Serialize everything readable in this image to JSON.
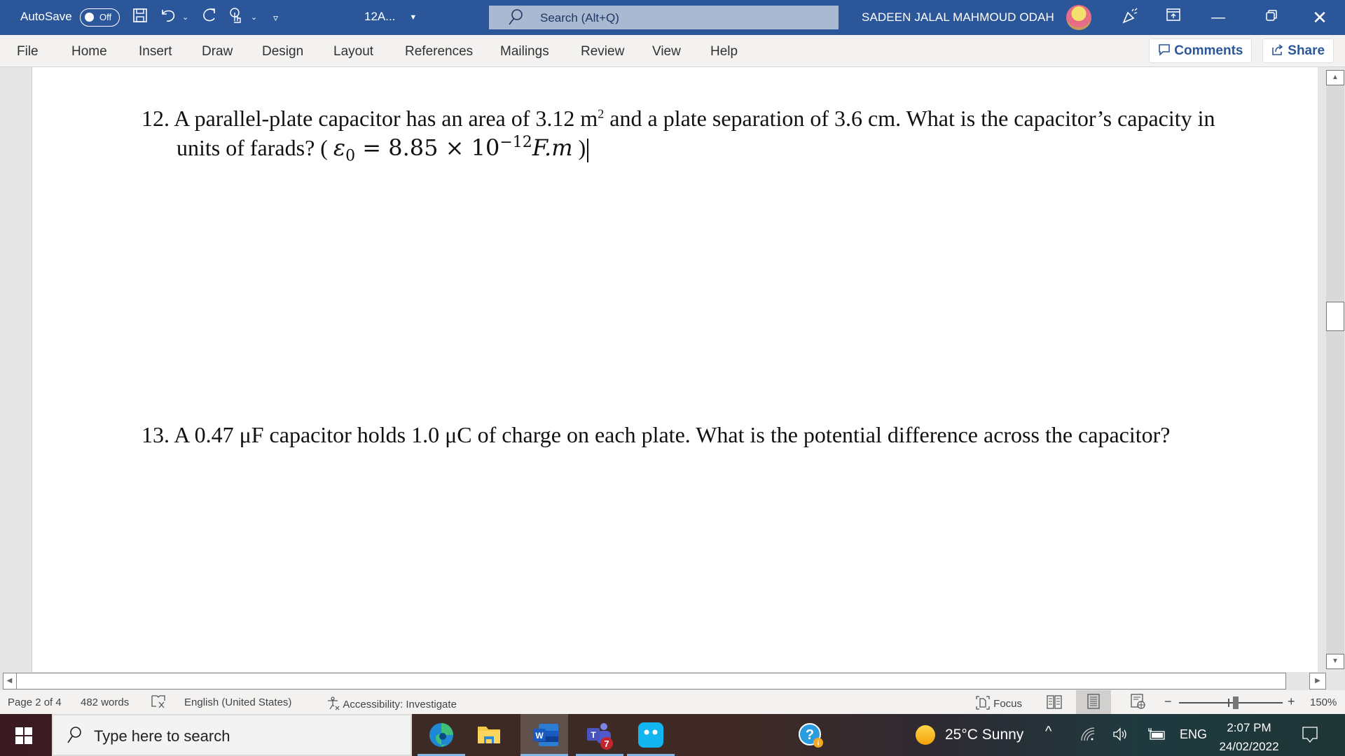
{
  "titlebar": {
    "autosave_label": "AutoSave",
    "autosave_state": "Off",
    "doc_name": "12A...",
    "search_placeholder": "Search (Alt+Q)",
    "user_name": "SADEEN JALAL MAHMOUD ODAH",
    "icons": [
      "save-icon",
      "undo-icon",
      "redo-icon",
      "touch-mode-icon",
      "customize-qat-icon",
      "coauthor-icon",
      "ribbon-display-icon",
      "minimize-icon",
      "restore-icon",
      "close-icon"
    ]
  },
  "ribbon": {
    "tabs": [
      "File",
      "Home",
      "Insert",
      "Draw",
      "Design",
      "Layout",
      "References",
      "Mailings",
      "Review",
      "View",
      "Help"
    ],
    "comments_label": "Comments",
    "share_label": "Share"
  },
  "document": {
    "q12": {
      "line1_pre": "12. A parallel-plate capacitor has an area of 3.12 m",
      "line1_sup": "2",
      "line1_post": " and a plate separation of 3.6 cm. What is the capacitor’s capacity in",
      "line2_text": "units of farads? ( ",
      "math_eps": "ε",
      "math_sub": "0",
      "math_eq": " = 8.85 × 10",
      "math_exp": "−12",
      "math_unit": "F.m",
      "line2_close": " )"
    },
    "q13": "13. A 0.47 μF capacitor holds 1.0 μC of charge on each plate. What is the potential difference across the capacitor?"
  },
  "statusbar": {
    "page": "Page 2 of 4",
    "words": "482 words",
    "language": "English (United States)",
    "accessibility": "Accessibility: Investigate",
    "focus": "Focus",
    "zoom": "150%",
    "zoom_minus": "−",
    "zoom_plus": "+"
  },
  "taskbar": {
    "search_placeholder": "Type here to search",
    "apps": [
      "Microsoft Edge",
      "File Explorer",
      "Microsoft Word",
      "Microsoft Teams",
      "Messenger app"
    ],
    "teams_badge": "7",
    "weather": "25°C  Sunny",
    "language": "ENG",
    "time": "2:07 PM",
    "date": "24/02/2022"
  }
}
